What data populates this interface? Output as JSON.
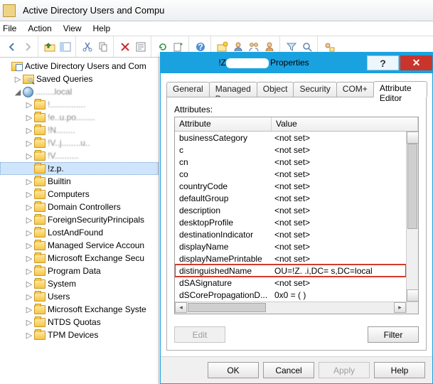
{
  "window": {
    "title": "Active Directory Users and Compu"
  },
  "menu": {
    "file": "File",
    "action": "Action",
    "view": "View",
    "help": "Help"
  },
  "tree": {
    "root": "Active Directory Users and Com",
    "saved": "Saved Queries",
    "domain": "........local",
    "nodes": [
      "!...............",
      "!e..u.po........",
      "!N........",
      "!V..j........u..",
      "!V..........",
      "!z.p.",
      "Builtin",
      "Computers",
      "Domain Controllers",
      "ForeignSecurityPrincipals",
      "LostAndFound",
      "Managed Service Accoun",
      "Microsoft Exchange Secu",
      "Program Data",
      "System",
      "Users",
      "Microsoft Exchange Syste",
      "NTDS Quotas",
      "TPM Devices"
    ],
    "selected_index": 5
  },
  "dialog": {
    "title_prefix": "!Z",
    "title_suffix": "Properties",
    "tabs": [
      "General",
      "Managed By",
      "Object",
      "Security",
      "COM+",
      "Attribute Editor"
    ],
    "active_tab": 5,
    "attributes_label": "Attributes:",
    "col_attribute": "Attribute",
    "col_value": "Value",
    "rows": [
      {
        "a": "businessCategory",
        "v": "<not set>"
      },
      {
        "a": "c",
        "v": "<not set>"
      },
      {
        "a": "cn",
        "v": "<not set>"
      },
      {
        "a": "co",
        "v": "<not set>"
      },
      {
        "a": "countryCode",
        "v": "<not set>"
      },
      {
        "a": "defaultGroup",
        "v": "<not set>"
      },
      {
        "a": "description",
        "v": "<not set>"
      },
      {
        "a": "desktopProfile",
        "v": "<not set>"
      },
      {
        "a": "destinationIndicator",
        "v": "<not set>"
      },
      {
        "a": "displayName",
        "v": "<not set>"
      },
      {
        "a": "displayNamePrintable",
        "v": "<not set>"
      },
      {
        "a": "distinguishedName",
        "v": "OU=!Z.       .i,DC=      s,DC=local"
      },
      {
        "a": "dSASignature",
        "v": "<not set>"
      },
      {
        "a": "dSCorePropagationD...",
        "v": "0x0 = (  )"
      }
    ],
    "highlight_index": 11,
    "edit_label": "Edit",
    "filter_label": "Filter",
    "ok": "OK",
    "cancel": "Cancel",
    "apply": "Apply",
    "help": "Help"
  }
}
